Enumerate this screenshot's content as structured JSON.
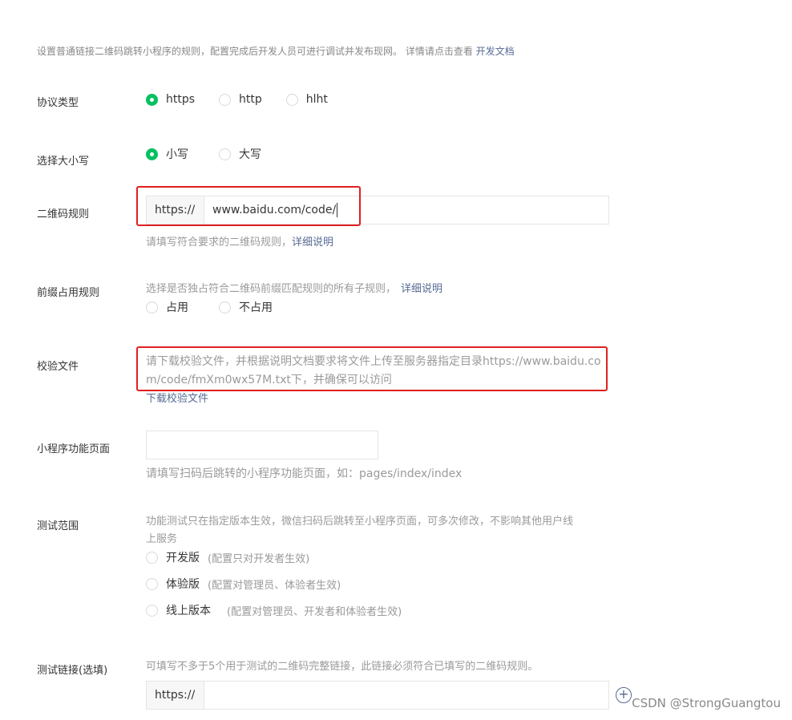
{
  "intro": {
    "text": "设置普通链接二维码跳转小程序的规则，配置完成后开发人员可进行调试并发布现网。 详情请点击查看",
    "link": "开发文档"
  },
  "protocol": {
    "label": "协议类型",
    "options": [
      "https",
      "http",
      "hlht"
    ],
    "selected": "https"
  },
  "case": {
    "label": "选择大小写",
    "options": [
      "小写",
      "大写"
    ],
    "selected": "小写"
  },
  "qr_rule": {
    "label": "二维码规则",
    "prefix": "https://",
    "value": "www.baidu.com/code/",
    "hint": "请填写符合要求的二维码规则，",
    "hint_link": "详细说明"
  },
  "prefix_rule": {
    "label": "前缀占用规则",
    "hint": "选择是否独占符合二维码前缀匹配规则的所有子规则，",
    "hint_link": "详细说明",
    "options": [
      "占用",
      "不占用"
    ]
  },
  "verify_file": {
    "label": "校验文件",
    "line1": "请下载校验文件，并根据说明文档要求将文件上传至服务器指定目录https://www.baidu.co",
    "line2": "m/code/fmXm0wx57M.txt下，并确保可以访问",
    "download_link": "下载校验文件"
  },
  "mp_page": {
    "label": "小程序功能页面",
    "value": "",
    "hint": "请填写扫码后跳转的小程序功能页面，如：pages/index/index"
  },
  "test_scope": {
    "label": "测试范围",
    "desc1": "功能测试只在指定版本生效，微信扫码后跳转至小程序页面，可多次修改，不影响其他用户线",
    "desc2": "上服务",
    "options": [
      {
        "name": "开发版",
        "note": "(配置只对开发者生效)"
      },
      {
        "name": "体验版",
        "note": "(配置对管理员、体验者生效)"
      },
      {
        "name": "线上版本",
        "note": "(配置对管理员、开发者和体验者生效)"
      }
    ]
  },
  "test_link": {
    "label": "测试链接(选填)",
    "hint": "可填写不多于5个用于测试的二维码完整链接，此链接必须符合已填写的二维码规则。",
    "prefix": "https://",
    "value": ""
  },
  "watermark": "CSDN @StrongGuangtou",
  "colors": {
    "accent_green": "#07c160",
    "link_blue": "#576b95",
    "annotation_red": "#e02020"
  }
}
